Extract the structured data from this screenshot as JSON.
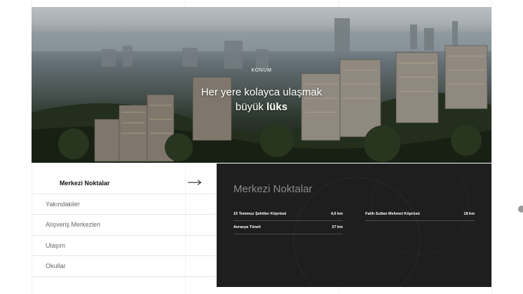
{
  "hero": {
    "eyebrow": "KONUM",
    "title_line1": "Her yere kolayca ulaşmak",
    "title_line2_regular": "büyük ",
    "title_line2_bold": "lüks"
  },
  "sidebar": {
    "items": [
      {
        "label": "Merkezi Noktalar",
        "active": true
      },
      {
        "label": "Yakındakiler",
        "active": false
      },
      {
        "label": "Alışveriş Merkezleri",
        "active": false
      },
      {
        "label": "Ulaşım",
        "active": false
      },
      {
        "label": "Okullar",
        "active": false
      }
    ]
  },
  "panel": {
    "title": "Merkezi Noktalar",
    "distances": [
      {
        "name": "15 Temmuz Şehitler Köprüsü",
        "value": "4,6 km"
      },
      {
        "name": "Fatih Sultan Mehmet Köprüsü",
        "value": "18 km"
      },
      {
        "name": "Avrasya Tüneli",
        "value": "27 km"
      }
    ]
  },
  "icons": {
    "arrow": "arrow-right-icon"
  },
  "colors": {
    "panel_bg": "#1e1e1e",
    "panel_title": "#8a8a8a",
    "divider": "#e6e6e6"
  }
}
